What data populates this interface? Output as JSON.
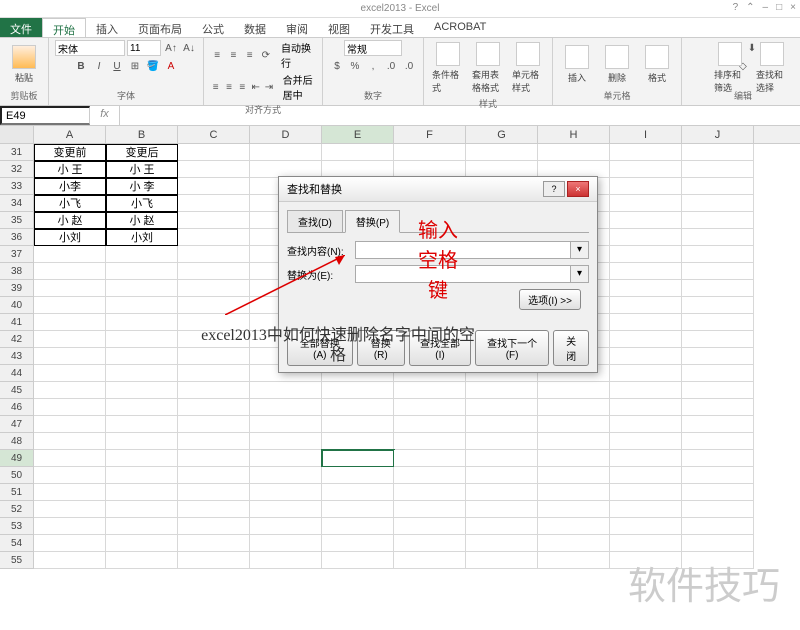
{
  "title": "excel2013 - Excel",
  "tabs": [
    "文件",
    "开始",
    "插入",
    "页面布局",
    "公式",
    "数据",
    "审阅",
    "视图",
    "开发工具",
    "ACROBAT"
  ],
  "activeTab": 1,
  "ribbon": {
    "clipboard": {
      "paste": "粘贴",
      "label": "剪贴板"
    },
    "font": {
      "name": "宋体",
      "size": "11",
      "label": "字体",
      "bold": "B",
      "italic": "I",
      "underline": "U"
    },
    "align": {
      "wrap": "自动换行",
      "merge": "合并后居中",
      "label": "对齐方式"
    },
    "number": {
      "format": "常规",
      "label": "数字"
    },
    "styles": {
      "cond": "条件格式",
      "table": "套用表格格式",
      "cell": "单元格样式",
      "label": "样式"
    },
    "cells": {
      "insert": "插入",
      "delete": "删除",
      "format": "格式",
      "label": "单元格"
    },
    "editing": {
      "sort": "排序和筛选",
      "find": "查找和选择",
      "label": "编辑"
    }
  },
  "namebox": "E49",
  "columns": [
    "A",
    "B",
    "C",
    "D",
    "E",
    "F",
    "G",
    "H",
    "I",
    "J"
  ],
  "activeCol": 4,
  "rows_start": 31,
  "rows_end": 55,
  "activeRow": 49,
  "table": {
    "31": [
      "变更前",
      "变更后"
    ],
    "32": [
      "小 王",
      "小 王"
    ],
    "33": [
      "小李",
      "小 李"
    ],
    "34": [
      "小飞",
      "小飞"
    ],
    "35": [
      "小  赵",
      "小  赵"
    ],
    "36": [
      "小刘",
      "小刘"
    ]
  },
  "dialog": {
    "title": "查找和替换",
    "tab_find": "查找(D)",
    "tab_replace": "替换(P)",
    "find_label": "查找内容(N):",
    "replace_label": "替换为(E):",
    "find_value": "",
    "replace_value": "",
    "options": "选项(I) >>",
    "btn_replace_all": "全部替换(A)",
    "btn_replace": "替换(R)",
    "btn_find_all": "查找全部(I)",
    "btn_find_next": "查找下一个(F)",
    "btn_close": "关闭"
  },
  "annotation": {
    "l1": "输入",
    "l2": "空格",
    "l3": "键"
  },
  "caption": "excel2013中如何快速删除名字中间的空格",
  "watermark": "软件技巧"
}
